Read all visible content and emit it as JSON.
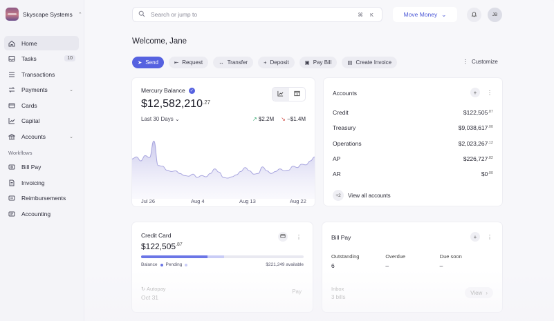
{
  "org": {
    "name": "Skyscape Systems"
  },
  "nav": {
    "items": [
      {
        "label": "Home",
        "icon": "home-icon",
        "active": true
      },
      {
        "label": "Tasks",
        "icon": "inbox-icon",
        "badge": "10"
      },
      {
        "label": "Transactions",
        "icon": "list-icon"
      },
      {
        "label": "Payments",
        "icon": "transfer-icon",
        "chevron": true
      },
      {
        "label": "Cards",
        "icon": "card-icon"
      },
      {
        "label": "Capital",
        "icon": "chart-icon"
      },
      {
        "label": "Accounts",
        "icon": "bank-icon",
        "chevron": true
      }
    ],
    "section_label": "Workflows",
    "workflow_items": [
      {
        "label": "Bill Pay",
        "icon": "bill-icon"
      },
      {
        "label": "Invoicing",
        "icon": "document-icon"
      },
      {
        "label": "Reimbursements",
        "icon": "receipt-icon"
      },
      {
        "label": "Accounting",
        "icon": "ledger-icon"
      }
    ]
  },
  "search": {
    "placeholder": "Search or jump to",
    "shortcut": "⌘ K"
  },
  "header": {
    "move_money": "Move Money",
    "avatar_initials": "JB"
  },
  "welcome": "Welcome, Jane",
  "actions": [
    {
      "label": "Send",
      "icon": "send-icon",
      "glyph": "➤",
      "primary": true
    },
    {
      "label": "Request",
      "icon": "request-icon",
      "glyph": "⇤"
    },
    {
      "label": "Transfer",
      "icon": "transfer-icon",
      "glyph": "↔"
    },
    {
      "label": "Deposit",
      "icon": "plus-icon",
      "glyph": "+"
    },
    {
      "label": "Pay Bill",
      "icon": "bill-icon",
      "glyph": "▣"
    },
    {
      "label": "Create Invoice",
      "icon": "document-icon",
      "glyph": "▤"
    }
  ],
  "customize": "Customize",
  "balance": {
    "title": "Mercury Balance",
    "amount": "$12,582,210",
    "cents": ".27",
    "period": "Last 30 Days",
    "money_in": "$2.2M",
    "money_out": "−$1.4M",
    "x_labels": [
      "Jul 26",
      "Aug 4",
      "Aug 13",
      "Aug 22"
    ],
    "series": [
      0.55,
      0.58,
      0.52,
      0.6,
      0.57,
      0.82,
      0.45,
      0.44,
      0.38,
      0.36,
      0.37,
      0.33,
      0.3,
      0.29,
      0.32,
      0.27,
      0.3,
      0.28,
      0.33,
      0.4,
      0.35,
      0.27,
      0.26,
      0.28,
      0.31,
      0.36,
      0.42,
      0.37,
      0.32,
      0.33,
      0.43,
      0.37,
      0.33,
      0.36,
      0.4,
      0.37,
      0.38,
      0.44,
      0.42,
      0.47,
      0.46,
      0.52,
      0.58
    ]
  },
  "accounts": {
    "title": "Accounts",
    "rows": [
      {
        "name": "Credit",
        "amount": "$122,505",
        "cents": ".87"
      },
      {
        "name": "Treasury",
        "amount": "$9,038,617",
        "cents": ".00"
      },
      {
        "name": "Operations",
        "amount": "$2,023,267",
        "cents": ".12"
      },
      {
        "name": "AP",
        "amount": "$226,727",
        "cents": ".82"
      },
      {
        "name": "AR",
        "amount": "$0",
        "cents": ".00"
      }
    ],
    "more_count": "+2",
    "view_all": "View all accounts"
  },
  "credit_card": {
    "title": "Credit Card",
    "amount": "$122,505",
    "cents": ".87",
    "balance_fraction": 0.41,
    "pending_fraction": 0.1,
    "legend_balance": "Balance",
    "legend_pending": "Pending",
    "available": "$221,249 available",
    "autopay_label": "Autopay",
    "autopay_date": "Oct 31",
    "pay_label": "Pay"
  },
  "bill_pay": {
    "title": "Bill Pay",
    "columns": [
      {
        "label": "Outstanding",
        "value": "6"
      },
      {
        "label": "Overdue",
        "value": "–"
      },
      {
        "label": "Due soon",
        "value": "–"
      }
    ],
    "inbox_label": "Inbox",
    "inbox_value": "3 bills",
    "view_label": "View"
  }
}
